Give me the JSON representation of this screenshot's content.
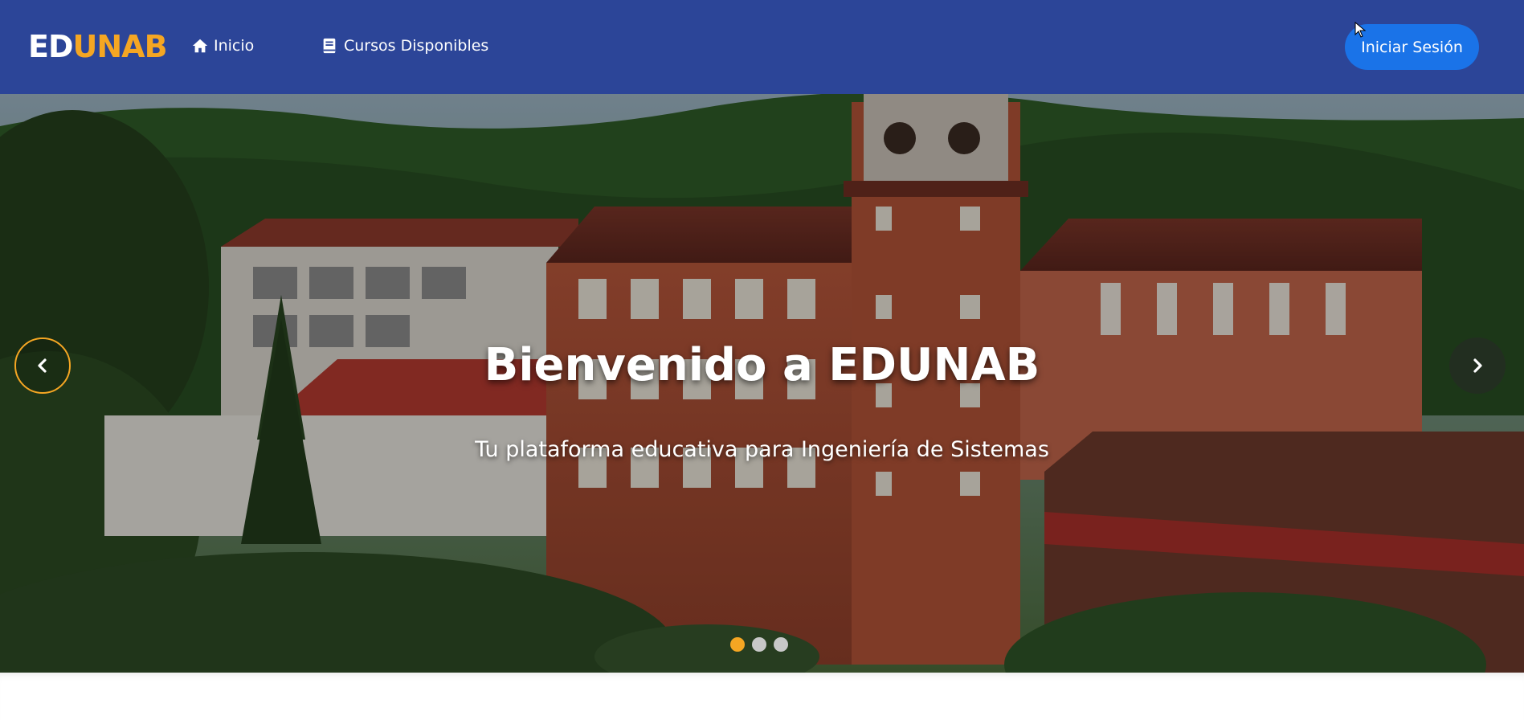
{
  "brand": {
    "part1": "ED",
    "part2": "UNAB",
    "color_primary": "#ffffff",
    "color_accent": "#f5a623"
  },
  "nav": {
    "background": "#2c4598",
    "items": [
      {
        "label": "Inicio",
        "icon": "home-icon"
      },
      {
        "label": "Cursos Disponibles",
        "icon": "book-icon"
      }
    ],
    "login_label": "Iniciar Sesión",
    "login_color": "#1a73e8"
  },
  "hero": {
    "title": "Bienvenido a EDUNAB",
    "subtitle": "Tu plataforma educativa para Ingeniería de Sistemas",
    "prev_icon": "chevron-left-icon",
    "next_icon": "chevron-right-icon",
    "slides_total": 3,
    "active_slide": 1
  }
}
